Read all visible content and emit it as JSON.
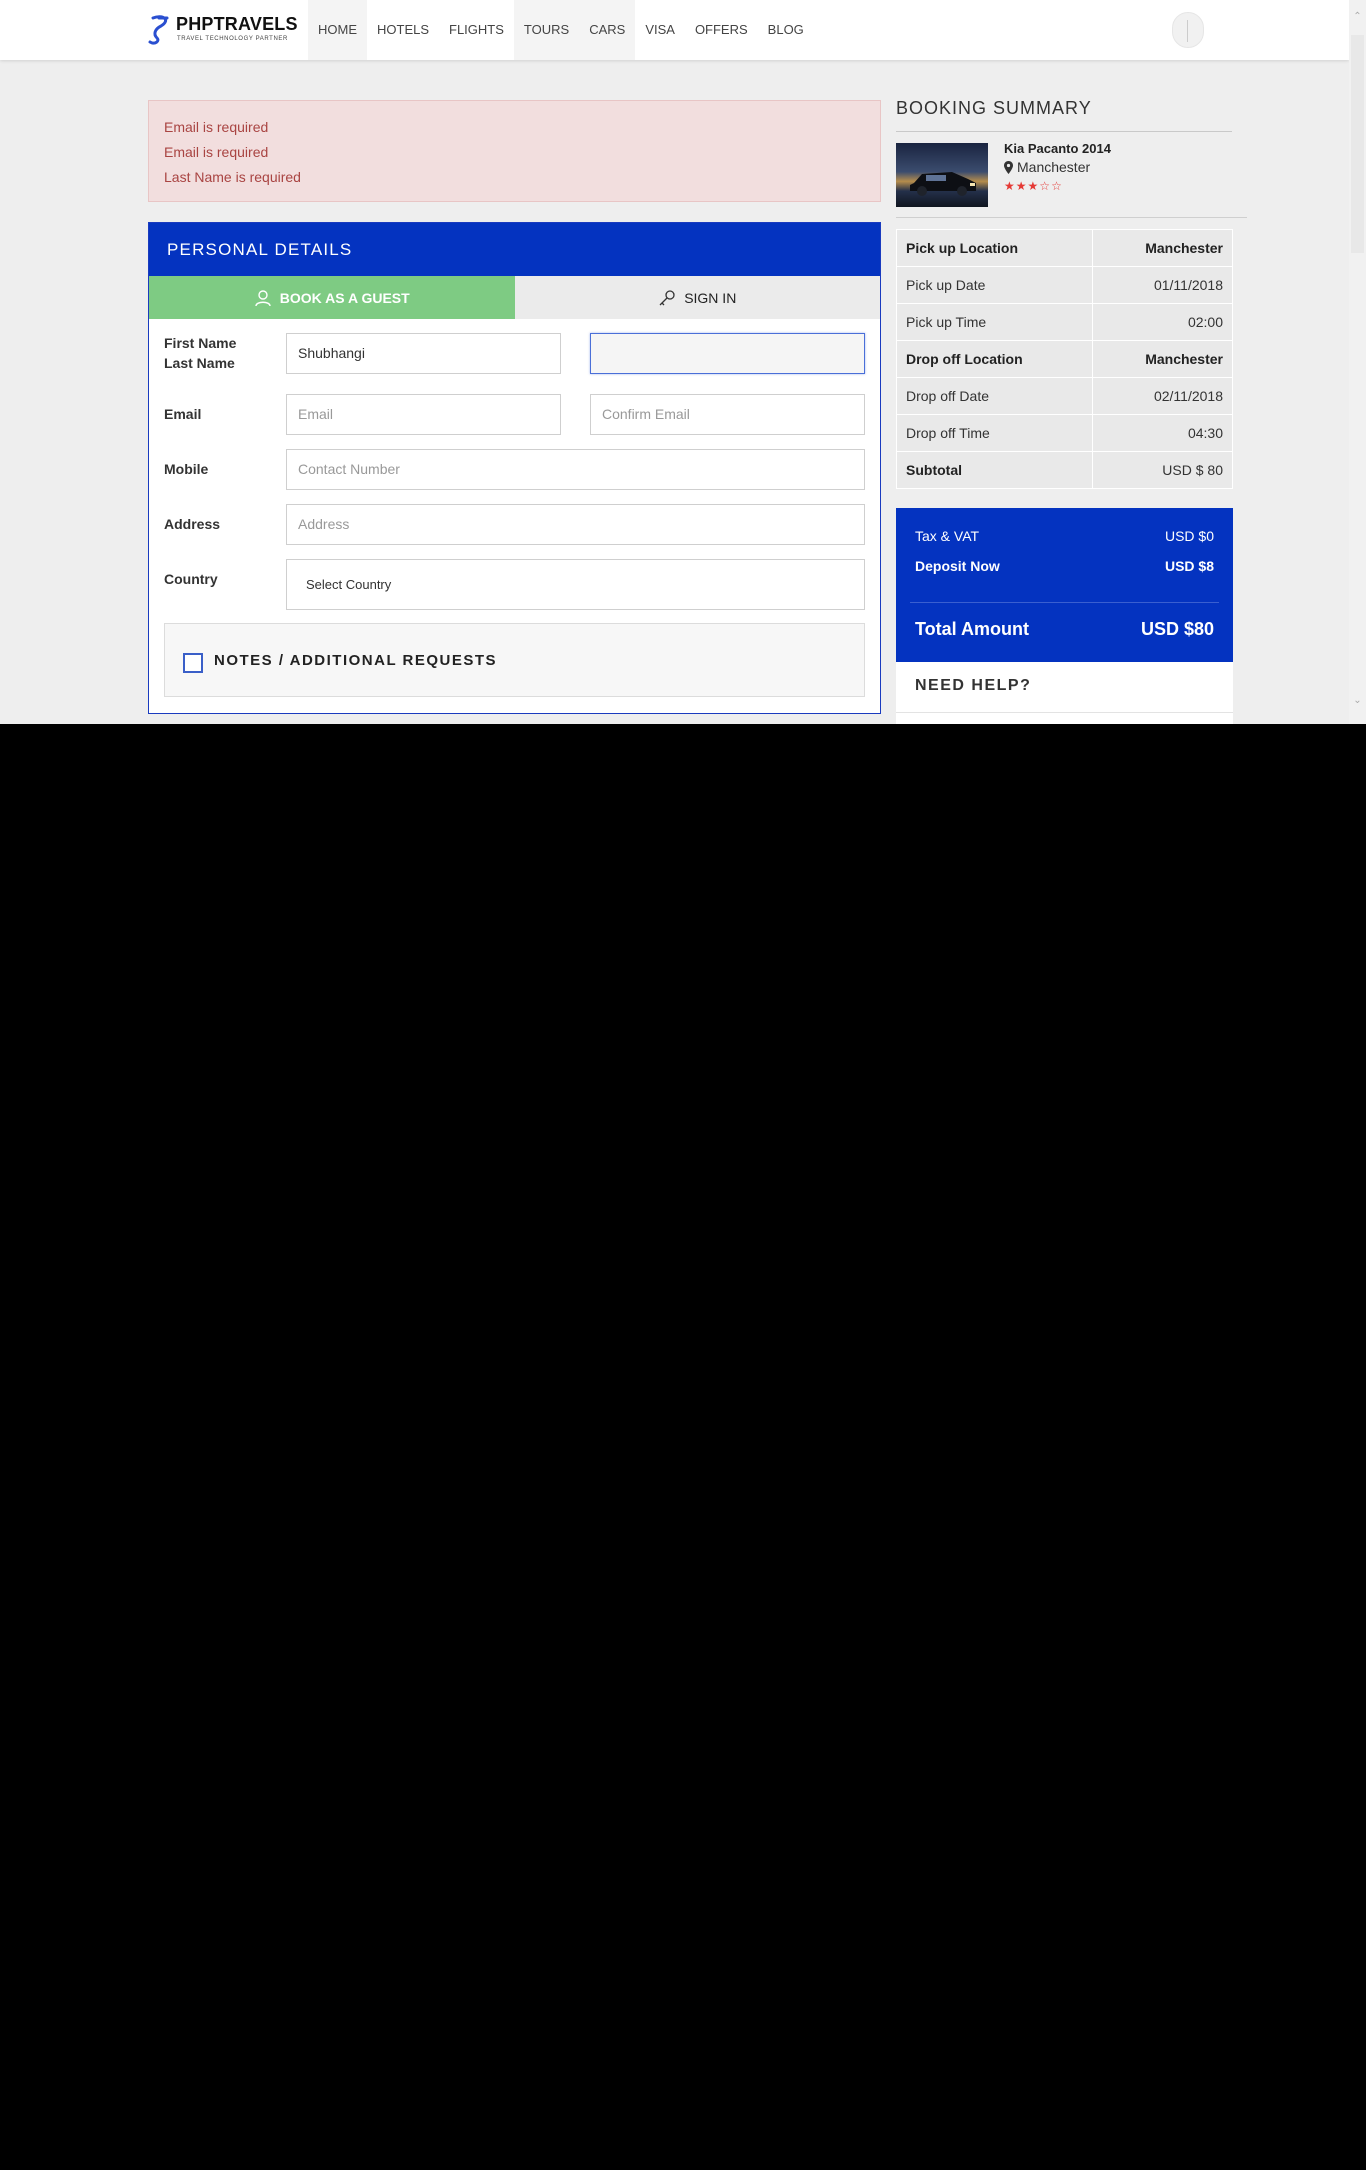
{
  "brand": {
    "name": "PHPTRAVELS",
    "tagline": "TRAVEL TECHNOLOGY PARTNER"
  },
  "nav": [
    "HOME",
    "HOTELS",
    "FLIGHTS",
    "TOURS",
    "CARS",
    "VISA",
    "OFFERS",
    "BLOG"
  ],
  "alerts": [
    "Email is required",
    "Email is required",
    "Last Name is required"
  ],
  "personal": {
    "title": "PERSONAL DETAILS",
    "tab_guest": "BOOK AS A GUEST",
    "tab_signin": "SIGN IN",
    "label_first": "First Name",
    "label_last": "Last Name",
    "first_name_value": "Shubhangi",
    "last_name_value": "",
    "label_email": "Email",
    "email_placeholder": "Email",
    "confirm_email_placeholder": "Confirm Email",
    "label_mobile": "Mobile",
    "mobile_placeholder": "Contact Number",
    "label_address": "Address",
    "address_placeholder": "Address",
    "label_country": "Country",
    "country_value": "Select Country",
    "notes_label": "NOTES / ADDITIONAL REQUESTS"
  },
  "summary": {
    "title": "BOOKING SUMMARY",
    "car_name": "Kia Pacanto 2014",
    "car_location": "Manchester",
    "rating": 3,
    "rating_max": 5,
    "rows": [
      {
        "label": "Pick up Location",
        "value": "Manchester",
        "bold": true
      },
      {
        "label": "Pick up Date",
        "value": "01/11/2018",
        "bold": false
      },
      {
        "label": "Pick up Time",
        "value": "02:00",
        "bold": false
      },
      {
        "label": "Drop off Location",
        "value": "Manchester",
        "bold": true
      },
      {
        "label": "Drop off Date",
        "value": "02/11/2018",
        "bold": false
      },
      {
        "label": "Drop off Time",
        "value": "04:30",
        "bold": false
      },
      {
        "label": "Subtotal",
        "value": "USD $ 80",
        "bold": "label"
      }
    ],
    "tax_label": "Tax & VAT",
    "tax_value": "USD $0",
    "deposit_label": "Deposit Now",
    "deposit_value": "USD $8",
    "total_label": "Total Amount",
    "total_value": "USD $80",
    "help_title": "NEED HELP?"
  },
  "colors": {
    "brand_blue": "#0433c0",
    "guest_green": "#7ecb83",
    "alert_bg": "#f2dede",
    "alert_text": "#a94442",
    "star_red": "#e53935"
  },
  "icons": [
    "user-icon",
    "key-icon",
    "map-marker-icon",
    "star-icon"
  ]
}
